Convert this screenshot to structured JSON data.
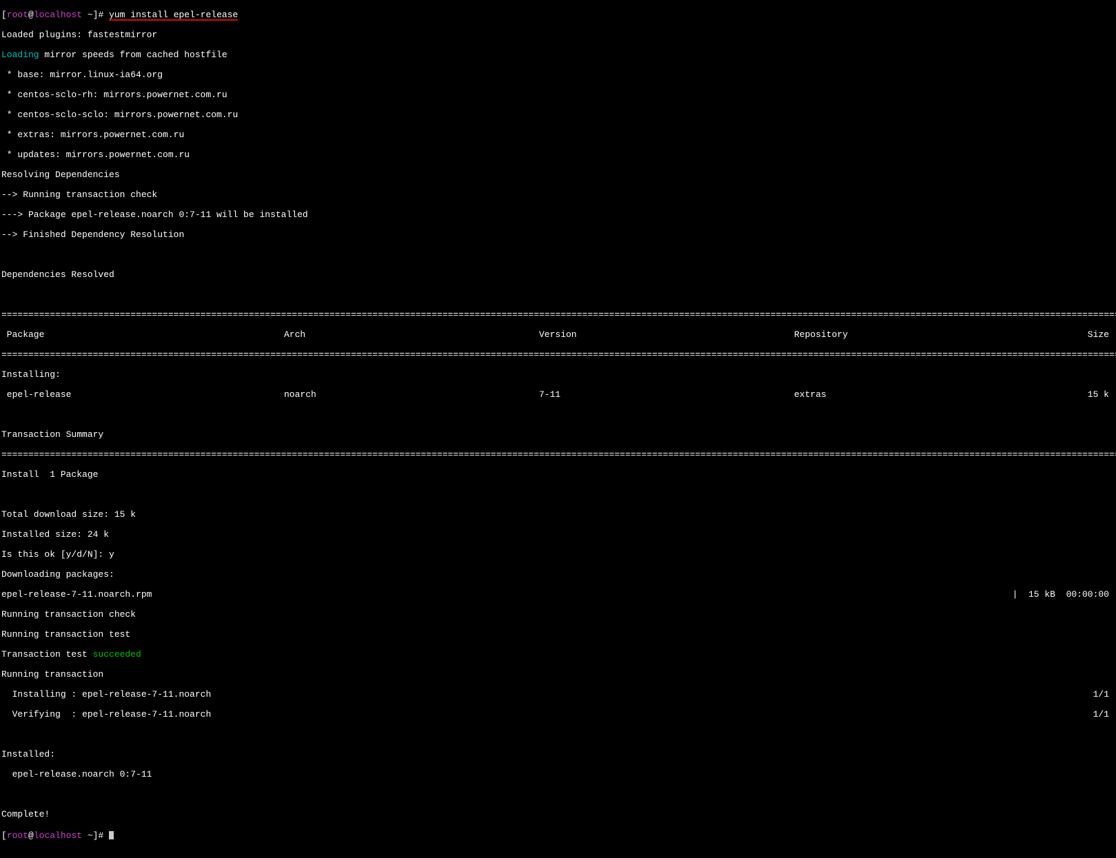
{
  "prompt": {
    "bracket_open": "[",
    "user": "root",
    "at": "@",
    "host": "localhost",
    "path": " ~",
    "bracket_close": "]# ",
    "command": "yum install epel-release"
  },
  "lines": {
    "loaded_plugins": "Loaded plugins: fastestmirror",
    "loading_word": "Loading",
    "loading_rest": " mirror speeds from cached hostfile",
    "mirror_base": " * base: mirror.linux-ia64.org",
    "mirror_sclo_rh": " * centos-sclo-rh: mirrors.powernet.com.ru",
    "mirror_sclo": " * centos-sclo-sclo: mirrors.powernet.com.ru",
    "mirror_extras": " * extras: mirrors.powernet.com.ru",
    "mirror_updates": " * updates: mirrors.powernet.com.ru",
    "resolving": "Resolving Dependencies",
    "trans_check": "--> Running transaction check",
    "pkg_install": "---> Package epel-release.noarch 0:7-11 will be installed",
    "finished_dep": "--> Finished Dependency Resolution",
    "dep_resolved": "Dependencies Resolved"
  },
  "table": {
    "headers": {
      "package": " Package",
      "arch": "Arch",
      "version": "Version",
      "repository": "Repository",
      "size": "Size"
    },
    "installing_label": "Installing:",
    "row": {
      "package": " epel-release",
      "arch": "noarch",
      "version": "7-11",
      "repository": "extras",
      "size": "15 k"
    }
  },
  "summary": {
    "title": "Transaction Summary",
    "install_count": "Install  1 Package",
    "dl_size": "Total download size: 15 k",
    "inst_size": "Installed size: 24 k",
    "confirm": "Is this ok [y/d/N]: y",
    "downloading": "Downloading packages:"
  },
  "download": {
    "left": "epel-release-7-11.noarch.rpm",
    "right": "|  15 kB  00:00:00"
  },
  "post": {
    "run_check": "Running transaction check",
    "run_test": "Running transaction test",
    "test_prefix": "Transaction test ",
    "test_result": "succeeded",
    "running": "Running transaction",
    "installing_line": "  Installing : epel-release-7-11.noarch",
    "installing_count": "1/1",
    "verifying_line": "  Verifying  : epel-release-7-11.noarch",
    "verifying_count": "1/1",
    "installed_header": "Installed:",
    "installed_pkg": "  epel-release.noarch 0:7-11",
    "complete": "Complete!"
  },
  "separator": "================================================================================================================================================================================================================================"
}
